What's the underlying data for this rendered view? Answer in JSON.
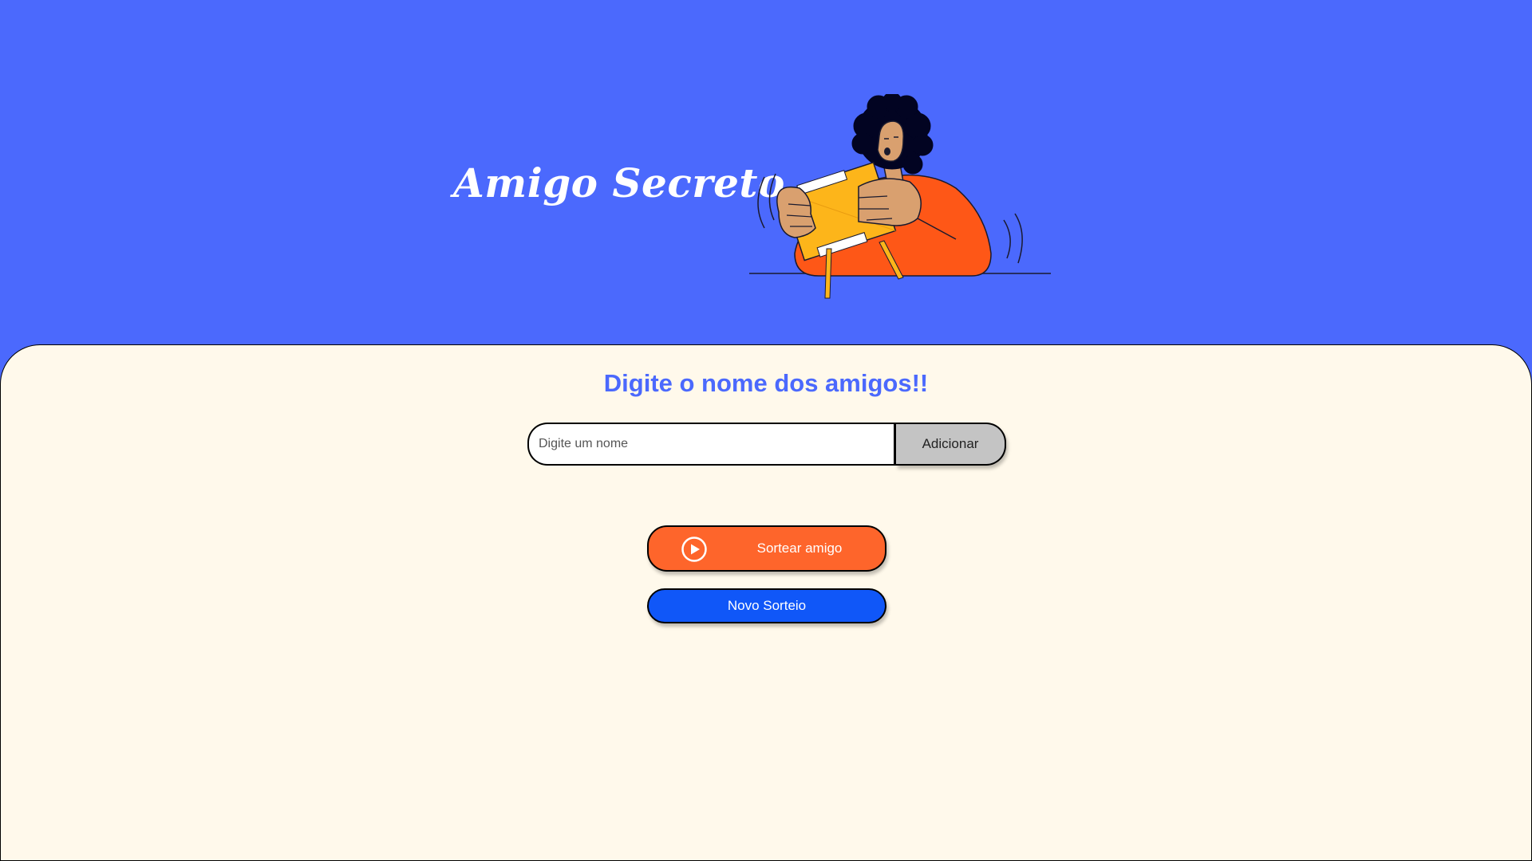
{
  "header": {
    "title": "Amigo Secreto",
    "illustration": "person-opening-gift-box-illustration"
  },
  "main": {
    "heading": "Digite o nome dos amigos!!",
    "name_input": {
      "value": "",
      "placeholder": "Digite um nome"
    },
    "add_button_label": "Adicionar",
    "draw_button": {
      "label": "Sortear amigo",
      "icon": "play-circle-icon"
    },
    "new_draw_button_label": "Novo Sorteio"
  },
  "colors": {
    "header_background": "#4b69fd",
    "content_background": "#fff9eb",
    "heading_text": "#4b69fd",
    "draw_button": "#fe652b",
    "new_draw_button": "#1057f8",
    "add_button": "#c4c4c4"
  }
}
